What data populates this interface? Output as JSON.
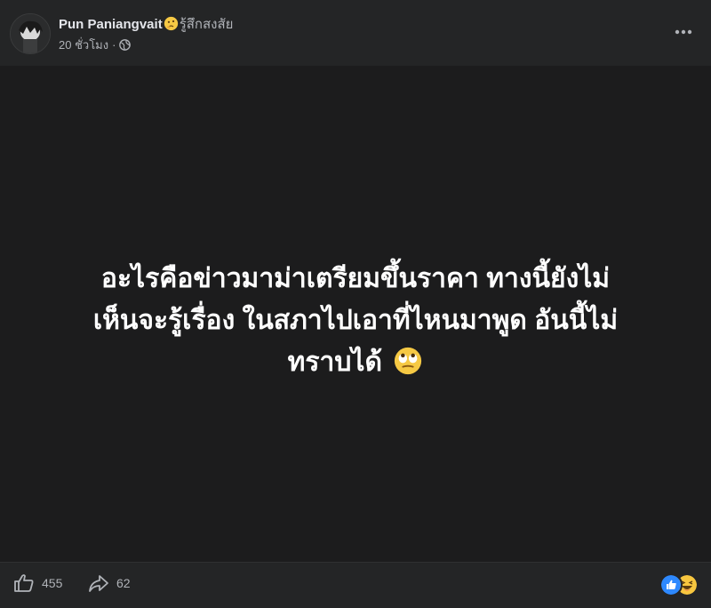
{
  "post": {
    "author": "Pun Paniangvait",
    "feeling": "รู้สึกสงสัย",
    "timestamp": "20 ชั่วโมง",
    "separator": "·",
    "privacy_icon": "globe-icon",
    "text_line1": "อะไรคือข่าวมาม่าเตรียมขึ้นราคา ทางนี้ยังไม่",
    "text_line2": "เห็นจะรู้เรื่อง ในสภาไปเอาที่ไหนมาพูด อันนี้ไม่",
    "text_line3": "ทราบได้",
    "background_color": "#1c1c1d"
  },
  "footer": {
    "likes": "455",
    "shares": "62",
    "reactions": [
      "like-icon",
      "haha-icon"
    ]
  }
}
